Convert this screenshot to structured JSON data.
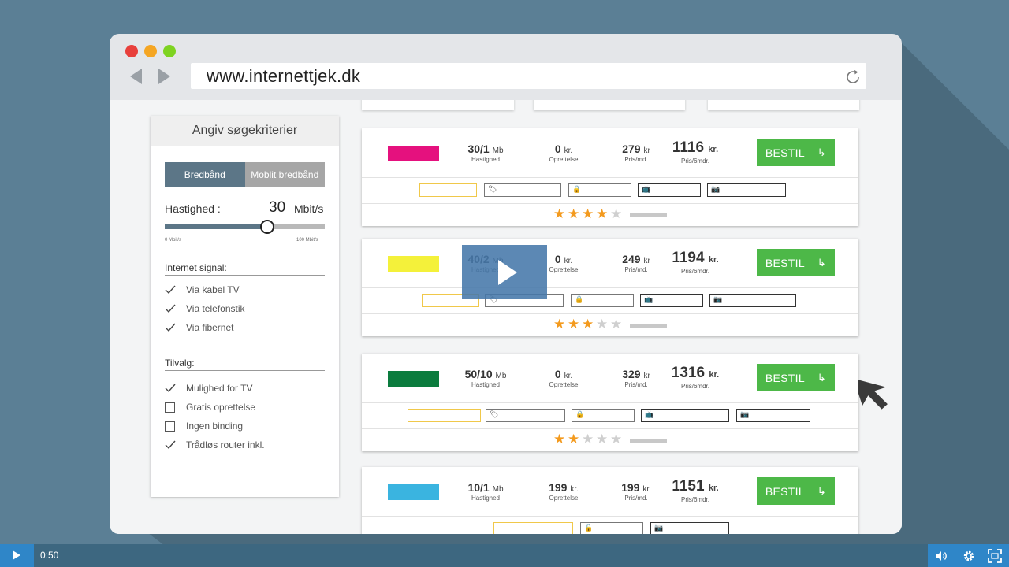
{
  "browser": {
    "url": "www.internettjek.dk"
  },
  "sidebar": {
    "title": "Angiv søgekriterier",
    "toggle": {
      "active": "Bredbånd",
      "inactive": "Moblit bredbånd"
    },
    "speed": {
      "label": "Hastighed :",
      "value": "30",
      "unit": "Mbit/s",
      "min_label": "0 Mbit/s",
      "max_label": "100 Mbit/s",
      "level_fraction": 0.64
    },
    "signal": {
      "title": "Internet signal:",
      "options": [
        {
          "label": "Via kabel TV",
          "checked": true
        },
        {
          "label": "Via telefonstik",
          "checked": true
        },
        {
          "label": "Via fibernet",
          "checked": true
        }
      ]
    },
    "addons": {
      "title": "Tilvalg:",
      "options": [
        {
          "label": "Mulighed for TV",
          "checked": true
        },
        {
          "label": "Gratis oprettelse",
          "checked": false
        },
        {
          "label": "Ingen binding",
          "checked": false
        },
        {
          "label": "Trådløs router inkl.",
          "checked": true
        }
      ]
    }
  },
  "offers": [
    {
      "color": "#e5117e",
      "speed": "30/1",
      "speed_unit": "Mb",
      "speed_label": "Hastighed",
      "setup": "0",
      "setup_unit": "kr.",
      "setup_label": "Oprettelse",
      "monthly": "279",
      "monthly_unit": "kr",
      "monthly_label": "Pris/md.",
      "total": "1116",
      "total_unit": "kr.",
      "total_label": "Pris/6mdr.",
      "button": "BESTIL",
      "rating": 4
    },
    {
      "color": "#f4f13a",
      "speed": "40/2",
      "speed_unit": "Mb",
      "speed_label": "Hastighed",
      "setup": "0",
      "setup_unit": "kr.",
      "setup_label": "Oprettelse",
      "monthly": "249",
      "monthly_unit": "kr",
      "monthly_label": "Pris/md.",
      "total": "1194",
      "total_unit": "kr.",
      "total_label": "Pris/6mdr.",
      "button": "BESTIL",
      "rating": 3
    },
    {
      "color": "#0b7c3e",
      "speed": "50/10",
      "speed_unit": "Mb",
      "speed_label": "Hastighed",
      "setup": "0",
      "setup_unit": "kr.",
      "setup_label": "Oprettelse",
      "monthly": "329",
      "monthly_unit": "kr",
      "monthly_label": "Pris/md.",
      "total": "1316",
      "total_unit": "kr.",
      "total_label": "Pris/6mdr.",
      "button": "BESTIL",
      "rating": 2
    },
    {
      "color": "#3ab4e0",
      "speed": "10/1",
      "speed_unit": "Mb",
      "speed_label": "Hastighed",
      "setup": "199",
      "setup_unit": "kr.",
      "setup_label": "Oprettelse",
      "monthly": "199",
      "monthly_unit": "kr.",
      "monthly_label": "Pris/md.",
      "total": "1151",
      "total_unit": "kr.",
      "total_label": "Pris/6mdr.",
      "button": "BESTIL",
      "rating": null
    }
  ],
  "player": {
    "time": "0:50"
  },
  "colors": {
    "accent_green": "#4db848",
    "slider": "#5c7687",
    "star": "#f39a1e",
    "player_blue": "#2f86c8"
  }
}
